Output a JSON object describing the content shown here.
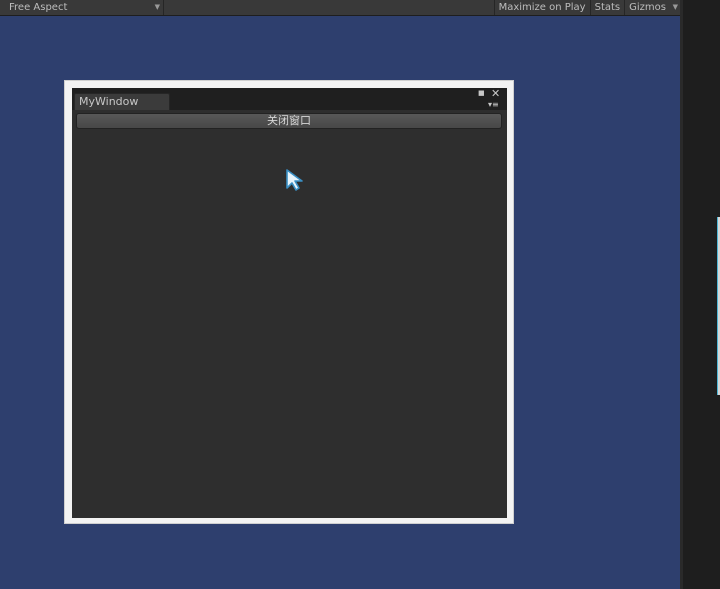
{
  "toolbar": {
    "aspect_label": "Free Aspect",
    "maximize_label": "Maximize on Play",
    "stats_label": "Stats",
    "gizmos_label": "Gizmos"
  },
  "window": {
    "tab_title": "MyWindow",
    "close_button_label": "关闭窗口"
  },
  "icons": {
    "dropdown": "chevron-down-icon",
    "maximize": "maximize-icon",
    "close": "close-icon",
    "menu": "menu-icon",
    "cursor": "mouse-cursor-icon"
  },
  "colors": {
    "background": "#2e3f6e",
    "window_body": "#2e2e2e",
    "window_frame": "#f3f3f3",
    "toolbar": "#393939",
    "cursor_outline": "#4fb7d6"
  }
}
